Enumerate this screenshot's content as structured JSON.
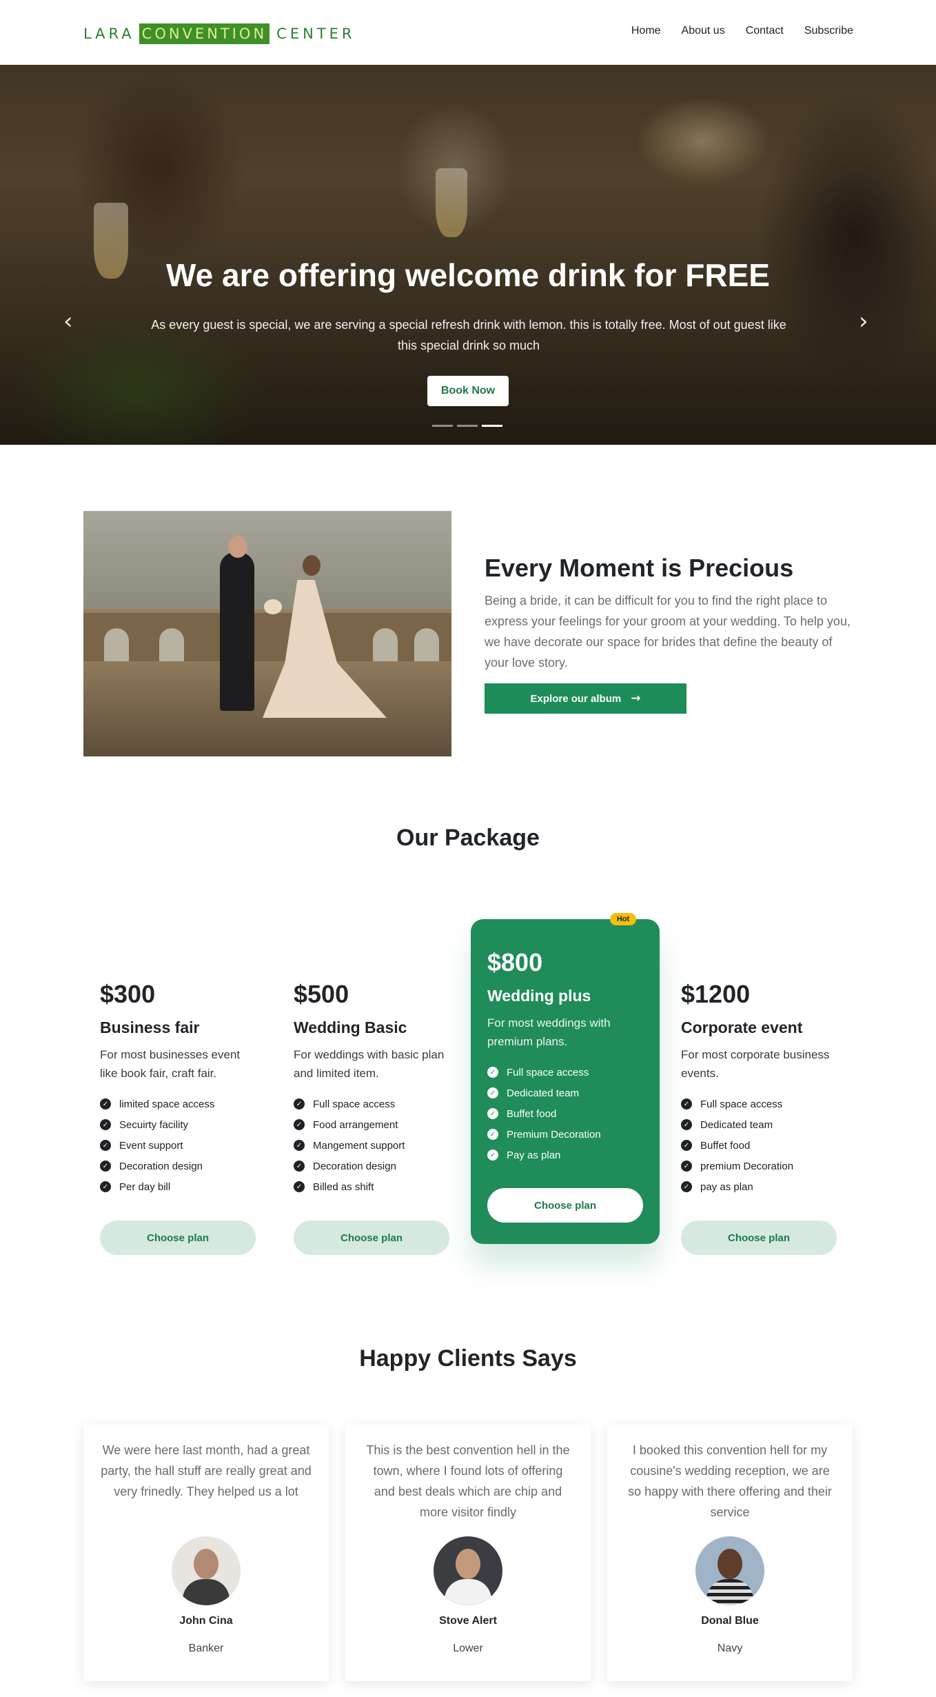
{
  "brand": {
    "left": "LARA",
    "middle": "CONVENTION",
    "right": "CENTER"
  },
  "nav": {
    "items": [
      "Home",
      "About us",
      "Contact",
      "Subscribe"
    ]
  },
  "hero": {
    "title": "We are offering welcome drink for FREE",
    "subtitle": "As every guest is special, we are serving a special refresh drink with lemon. this is totally free. Most of out guest like this special drink so much",
    "button": "Book Now",
    "prev_icon": "chevron-left-icon",
    "next_icon": "chevron-right-icon",
    "slide_count": 3,
    "active_slide": 3
  },
  "about": {
    "title": "Every Moment is Precious",
    "text": "Being a bride, it can be difficult for you to find the right place to express your feelings for your groom at your wedding. To help you, we have decorate our space for brides that define the beauty of your love story.",
    "button": "Explore our album",
    "button_icon": "arrow-right-icon"
  },
  "packages": {
    "title": "Our Package",
    "plans": [
      {
        "price": "$300",
        "name": "Business fair",
        "desc": "For most businesses event like book fair, craft fair.",
        "features": [
          "limited space access",
          "Secuirty facility",
          "Event support",
          "Decoration design",
          "Per day bill"
        ],
        "button": "Choose plan"
      },
      {
        "price": "$500",
        "name": "Wedding Basic",
        "desc": "For weddings with basic plan and limited item.",
        "features": [
          "Full space access",
          "Food arrangement",
          "Mangement support",
          "Decoration design",
          "Billed as shift"
        ],
        "button": "Choose plan"
      },
      {
        "price": "$800",
        "name": "Wedding plus",
        "desc": "For most weddings with premium plans.",
        "features": [
          "Full space access",
          "Dedicated team",
          "Buffet food",
          "Premium Decoration",
          "Pay as plan"
        ],
        "button": "Choose plan",
        "badge": "Hot"
      },
      {
        "price": "$1200",
        "name": "Corporate event",
        "desc": "For most corporate business events.",
        "features": [
          "Full space access",
          "Dedicated team",
          "Buffet food",
          "premium Decoration",
          "pay as plan"
        ],
        "button": "Choose plan"
      }
    ]
  },
  "testimonials": {
    "title": "Happy Clients Says",
    "items": [
      {
        "quote": "We were here last month, had a great party, the hall stuff are really great and very frinedly. They helped us a lot",
        "name": "John Cina",
        "role": "Banker"
      },
      {
        "quote": "This is the best convention hell in the town, where I found lots of offering and best deals which are chip and more visitor findly",
        "name": "Stove Alert",
        "role": "Lower"
      },
      {
        "quote": "I booked this convention hell for my cousine's wedding reception, we are so happy with there offering and their service",
        "name": "Donal Blue",
        "role": "Navy"
      }
    ]
  },
  "colors": {
    "brand_green": "#1f8c59",
    "hot_badge": "#f3c011",
    "plan_button_bg": "#d5e9df"
  }
}
